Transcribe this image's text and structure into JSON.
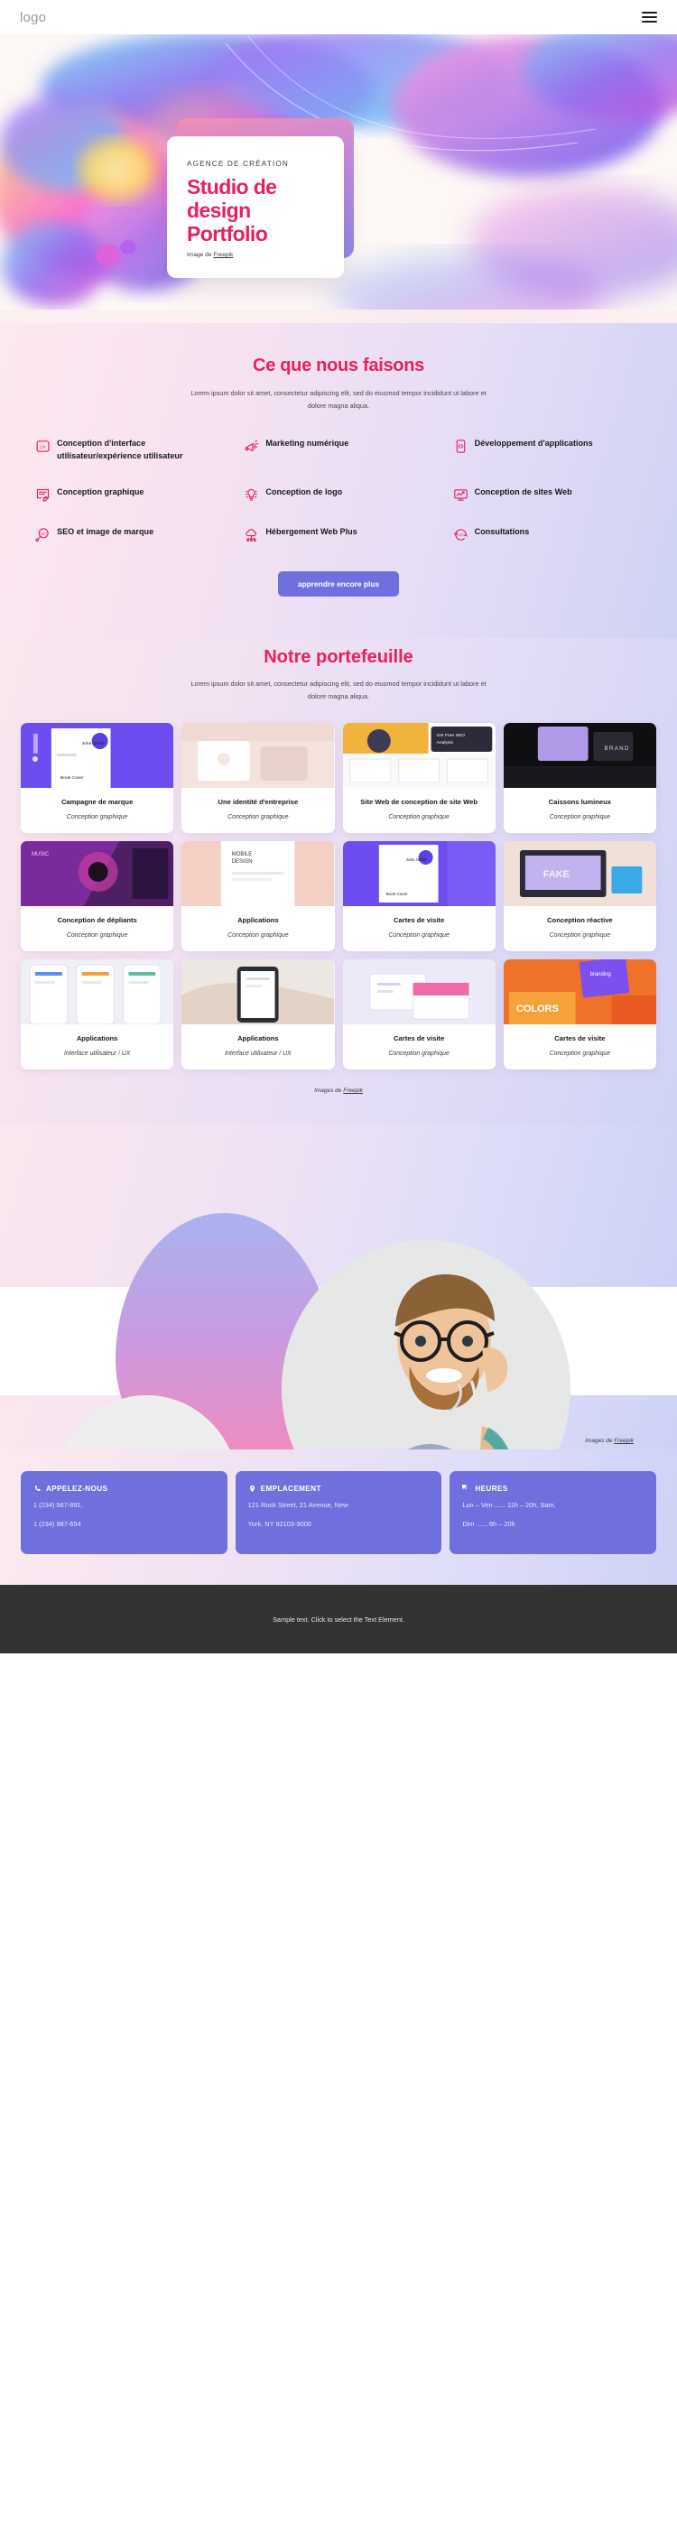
{
  "header": {
    "logo": "logo",
    "menu_label": "menu"
  },
  "hero": {
    "eyebrow": "AGENCE DE CRÉATION",
    "title_line1": "Studio de",
    "title_line2": "design",
    "title_line3": "Portfolio",
    "credit_prefix": "Image de ",
    "credit_link": "Freepik",
    "accent_color": "#e8205e"
  },
  "services": {
    "title": "Ce que nous faisons",
    "subtitle": "Lorem ipsum dolor sit amet, consectetur adipiscing elit, sed do eiusmod tempor incididunt ut labore et dolore magna aliqua.",
    "items": [
      {
        "label": "Conception d'interface utilisateur/expérience utilisateur",
        "icon": "ux-box-icon"
      },
      {
        "label": "Marketing numérique",
        "icon": "megaphone-icon"
      },
      {
        "label": "Développement d'applications",
        "icon": "code-phone-icon"
      },
      {
        "label": "Conception graphique",
        "icon": "pen-document-icon"
      },
      {
        "label": "Conception de logo",
        "icon": "lightbulb-icon"
      },
      {
        "label": "Conception de sites Web",
        "icon": "monitor-chart-icon"
      },
      {
        "label": "SEO et image de marque",
        "icon": "seo-magnifier-icon"
      },
      {
        "label": "Hébergement Web Plus",
        "icon": "cloud-hosting-icon"
      },
      {
        "label": "Consultations",
        "icon": "clock-247-icon"
      }
    ],
    "cta_label": "apprendre encore plus",
    "cta_color": "#6f6fdd"
  },
  "portfolio": {
    "title": "Notre portefeuille",
    "subtitle": "Lorem ipsum dolor sit amet, consectetur adipiscing elit, sed do eiusmod tempor incididunt ut labore et dolore magna aliqua.",
    "credit_prefix": "Images de ",
    "credit_link": "Freepik",
    "items": [
      {
        "name": "Campagne de marque",
        "category": "Conception graphique",
        "thumb": "brand-campaign-thumb"
      },
      {
        "name": "Une identité d'entreprise",
        "category": "Conception graphique",
        "thumb": "corporate-identity-thumb"
      },
      {
        "name": "Site Web de conception de site Web",
        "category": "Conception graphique",
        "thumb": "web-design-site-thumb"
      },
      {
        "name": "Caissons lumineux",
        "category": "Conception graphique",
        "thumb": "lightbox-thumb"
      },
      {
        "name": "Conception de dépliants",
        "category": "Conception graphique",
        "thumb": "flyer-design-thumb"
      },
      {
        "name": "Applications",
        "category": "Conception graphique",
        "thumb": "apps-phone-thumb"
      },
      {
        "name": "Cartes de visite",
        "category": "Conception graphique",
        "thumb": "business-cards-thumb"
      },
      {
        "name": "Conception réactive",
        "category": "Conception graphique",
        "thumb": "responsive-design-thumb"
      },
      {
        "name": "Applications",
        "category": "Interface utilisateur / UX",
        "thumb": "app-screens-thumb"
      },
      {
        "name": "Applications",
        "category": "Interface utilisateur / UX",
        "thumb": "hand-phone-thumb"
      },
      {
        "name": "Cartes de visite",
        "category": "Conception graphique",
        "thumb": "card-stack-thumb"
      },
      {
        "name": "Cartes de visite",
        "category": "Conception graphique",
        "thumb": "orange-cards-thumb"
      }
    ]
  },
  "band": {
    "credit_prefix": "Images de ",
    "credit_link": "Freepik"
  },
  "contact": {
    "cards": [
      {
        "title": "APPELEZ-NOUS",
        "icon": "phone-icon",
        "lines": [
          "1 (234) 567-891,",
          "1 (234) 987-654"
        ]
      },
      {
        "title": "EMPLACEMENT",
        "icon": "map-pin-icon",
        "lines": [
          "121 Rock Street, 21 Avenue, New",
          "York, NY 92103-9000"
        ]
      },
      {
        "title": "HEURES",
        "icon": "clock-icon",
        "lines": [
          "Lun – Ven ...... 11h – 20h, Sam,",
          "Dim  ...... 6h – 20h"
        ]
      }
    ],
    "card_color": "#6f6fdd"
  },
  "footer": {
    "text": "Sample text. Click to select the Text Element."
  }
}
